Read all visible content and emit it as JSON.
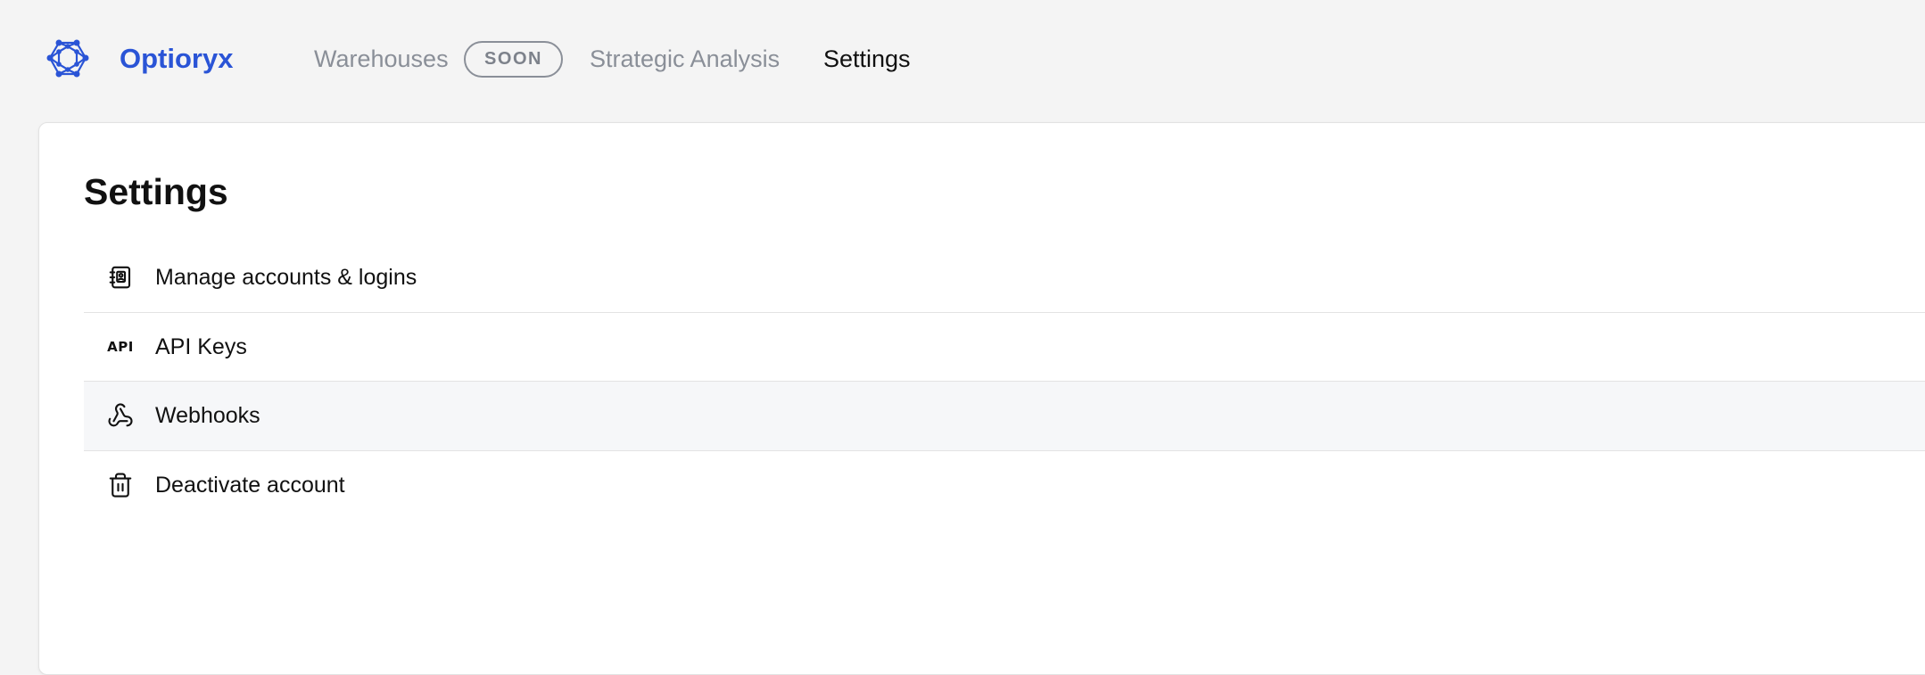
{
  "colors": {
    "brand": "#2a54d6",
    "muted_nav": "#8a8f98",
    "active_nav": "#111111",
    "page_background": "#f4f4f4",
    "card_background": "#ffffff",
    "row_hover": "#f6f7f9"
  },
  "header": {
    "logo_icon": "hexagon-network-logo",
    "brand_name": "Optioryx",
    "nav": {
      "warehouses": "Warehouses",
      "soon_badge": "SOON",
      "strategic_analysis": "Strategic Analysis",
      "settings": "Settings"
    },
    "active_nav": "Settings"
  },
  "main": {
    "title": "Settings",
    "items": [
      {
        "label": "Manage accounts & logins",
        "icon": "address-book-icon",
        "highlighted": false
      },
      {
        "label": "API Keys",
        "icon": "api-icon",
        "icon_text": "API",
        "highlighted": false
      },
      {
        "label": "Webhooks",
        "icon": "webhook-icon",
        "highlighted": true
      },
      {
        "label": "Deactivate account",
        "icon": "trash-icon",
        "highlighted": false
      }
    ]
  }
}
